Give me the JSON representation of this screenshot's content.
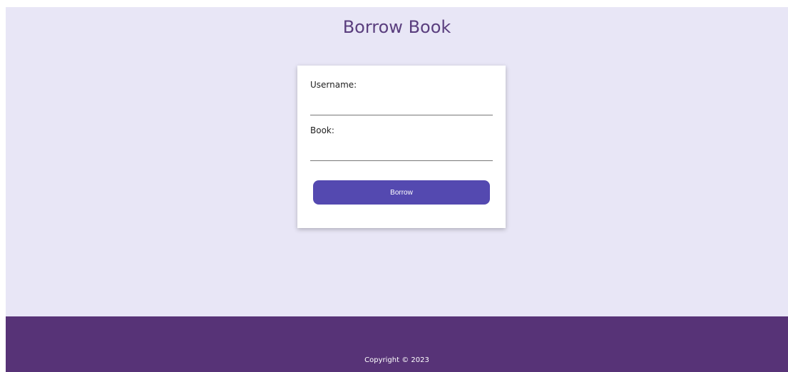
{
  "page": {
    "title": "Borrow Book"
  },
  "form": {
    "username_label": "Username:",
    "username_value": "",
    "book_label": "Book:",
    "book_value": "",
    "submit_label": "Borrow"
  },
  "footer": {
    "copyright": "Copyright © 2023"
  },
  "colors": {
    "background": "#e8e6f6",
    "title": "#5a3e7e",
    "button": "#5449b0",
    "footer": "#573377"
  }
}
